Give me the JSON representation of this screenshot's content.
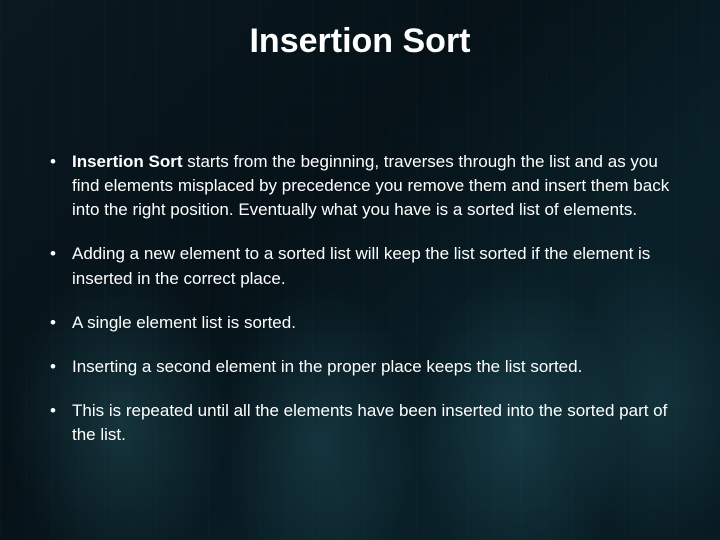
{
  "slide": {
    "title": "Insertion Sort",
    "bullets": [
      {
        "lead": "Insertion Sort",
        "rest": " starts from the beginning, traverses through the list and as you find elements misplaced by precedence you remove them and insert them back into the right position. Eventually what you have is a sorted list of elements."
      },
      {
        "lead": "",
        "rest": "Adding a new element to a sorted list will keep the list sorted if the element is inserted in the correct place."
      },
      {
        "lead": "",
        "rest": "A single element list is sorted."
      },
      {
        "lead": "",
        "rest": "Inserting a second element in the proper place keeps the list sorted."
      },
      {
        "lead": "",
        "rest": "This is repeated until all the elements have been inserted into the sorted part of the list."
      }
    ]
  }
}
